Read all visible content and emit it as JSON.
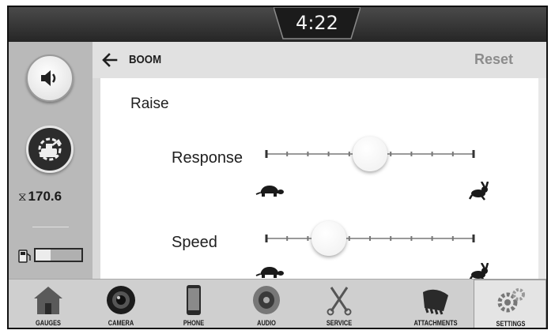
{
  "status_bar": {
    "clock": "4:22"
  },
  "left_panel": {
    "sound_icon": "speaker-icon",
    "machine_icon": "machine-settings-icon",
    "hour_meter": {
      "icon": "hourglass-icon",
      "value": "170.6"
    },
    "fuel": {
      "icon": "fuel-pump-icon",
      "level": 0.32
    }
  },
  "header": {
    "title": "BOOM",
    "reset_label": "Reset"
  },
  "content": {
    "section_title": "Raise",
    "sliders": [
      {
        "label": "Response",
        "min_icon": "turtle-icon",
        "max_icon": "rabbit-icon",
        "value": 0.5
      },
      {
        "label": "Speed",
        "min_icon": "turtle-icon",
        "max_icon": "rabbit-icon",
        "value": 0.3
      }
    ]
  },
  "nav": {
    "items": [
      {
        "label": "GAUGES",
        "icon": "house-icon"
      },
      {
        "label": "CAMERA",
        "icon": "camera-icon"
      },
      {
        "label": "PHONE",
        "icon": "phone-icon"
      },
      {
        "label": "AUDIO",
        "icon": "speaker-icon"
      },
      {
        "label": "SERVICE",
        "icon": "tools-icon"
      },
      {
        "label": "ATTACHMENTS",
        "icon": "bucket-icon"
      },
      {
        "label": "SETTINGS",
        "icon": "gears-icon"
      }
    ],
    "active": "SETTINGS"
  }
}
